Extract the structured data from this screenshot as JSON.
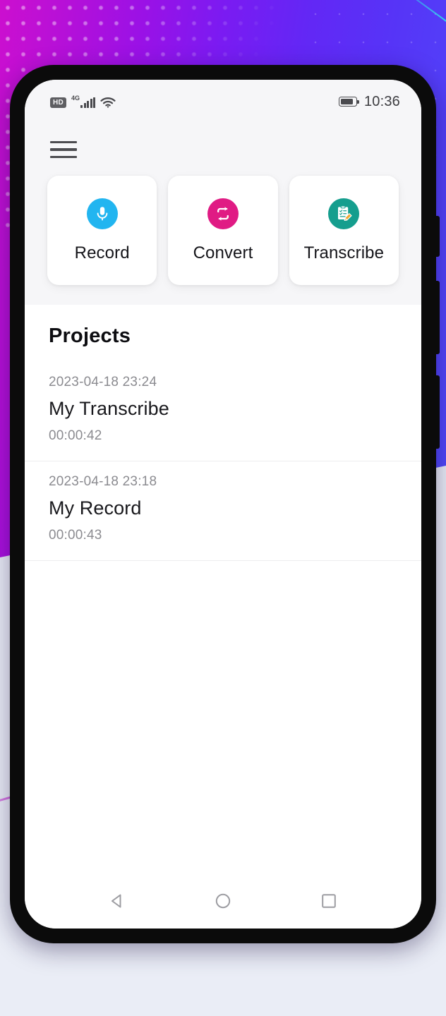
{
  "background": {
    "gradient_from": "#CC0FCF",
    "gradient_mid": "#7A1BF2",
    "gradient_to": "#4F4AF9",
    "page_base": "#EAEDF6",
    "accent_cyan": "#29E6DE",
    "accent_magenta": "#C317CE"
  },
  "status_bar": {
    "hd_label": "HD",
    "network_label": "4G",
    "signal_icon": "signal-bars-icon",
    "wifi_icon": "wifi-icon",
    "battery_icon": "battery-icon",
    "time": "10:36"
  },
  "app_bar": {
    "menu_icon": "hamburger-menu-icon"
  },
  "actions": [
    {
      "label": "Record",
      "icon": "microphone-icon",
      "color": "#22B5F0"
    },
    {
      "label": "Convert",
      "icon": "repeat-arrows-icon",
      "color": "#E01B84"
    },
    {
      "label": "Transcribe",
      "icon": "clipboard-pencil-icon",
      "color": "#159E8E"
    }
  ],
  "projects": {
    "title": "Projects",
    "items": [
      {
        "date": "2023-04-18 23:24",
        "name": "My Transcribe",
        "duration": "00:00:42"
      },
      {
        "date": "2023-04-18 23:18",
        "name": "My Record",
        "duration": "00:00:43"
      }
    ]
  },
  "nav_bar": {
    "back_icon": "back-triangle-icon",
    "home_icon": "home-circle-icon",
    "recents_icon": "recents-square-icon"
  }
}
